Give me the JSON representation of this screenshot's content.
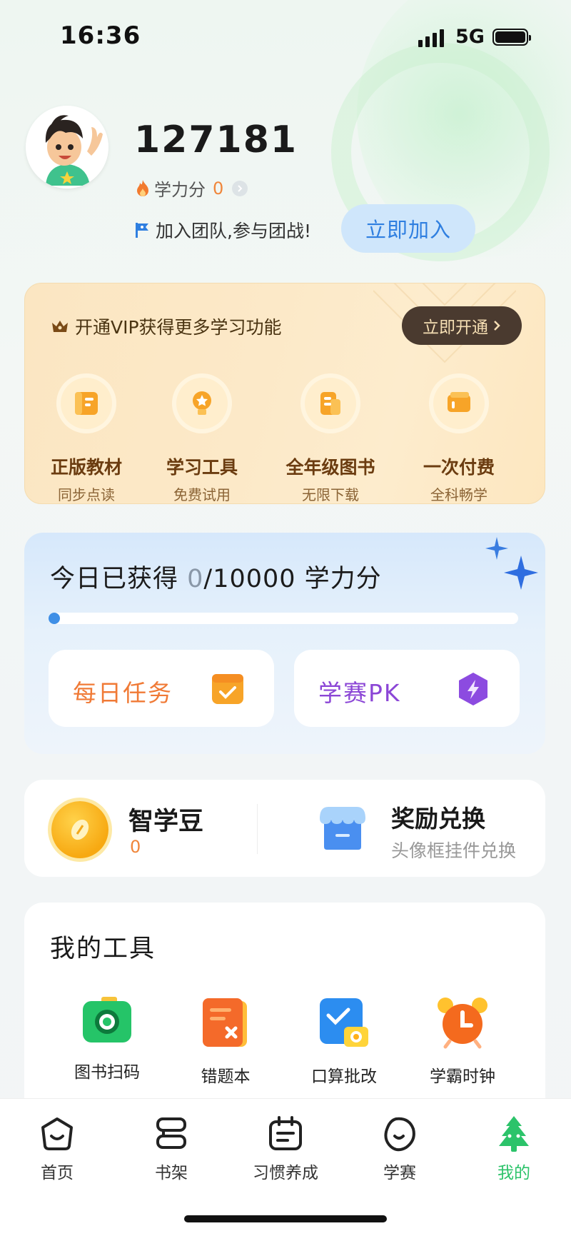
{
  "status_bar": {
    "time": "16:36",
    "network": "5G"
  },
  "profile": {
    "username": "127181",
    "score_label": "学力分",
    "score_value": "0",
    "team_text": "加入团队,参与团战!",
    "join_button": "立即加入"
  },
  "vip": {
    "title": "开通VIP获得更多学习功能",
    "button": "立即开通",
    "items": [
      {
        "name": "正版教材",
        "sub": "同步点读",
        "icon": "textbook-icon"
      },
      {
        "name": "学习工具",
        "sub": "免费试用",
        "icon": "lightbulb-icon"
      },
      {
        "name": "全年级图书",
        "sub": "无限下载",
        "icon": "book-icon"
      },
      {
        "name": "一次付费",
        "sub": "全科畅学",
        "icon": "card-icon"
      }
    ]
  },
  "daily": {
    "title_prefix": "今日已获得 ",
    "earned": "0",
    "title_suffix": "/10000 学力分",
    "progress_fraction": 0,
    "task_button": "每日任务",
    "pk_button": "学赛PK"
  },
  "beans": {
    "title": "智学豆",
    "value": "0",
    "reward_title": "奖励兑换",
    "reward_sub": "头像框挂件兑换"
  },
  "tools": {
    "title": "我的工具",
    "items": [
      {
        "name": "图书扫码",
        "icon": "camera-scan-icon"
      },
      {
        "name": "错题本",
        "icon": "mistake-notebook-icon"
      },
      {
        "name": "口算批改",
        "icon": "photo-check-icon"
      },
      {
        "name": "学霸时钟",
        "icon": "alarm-clock-icon"
      }
    ]
  },
  "tabbar": {
    "items": [
      {
        "label": "首页",
        "icon": "home-icon"
      },
      {
        "label": "书架",
        "icon": "bookshelf-icon"
      },
      {
        "label": "习惯养成",
        "icon": "habit-icon"
      },
      {
        "label": "学赛",
        "icon": "contest-icon"
      },
      {
        "label": "我的",
        "icon": "tree-icon"
      }
    ],
    "active": "我的"
  },
  "colors": {
    "accent_green": "#2cc36a",
    "accent_blue": "#2f7fe0",
    "accent_orange": "#f0863b",
    "vip_dark": "#4a3a2f"
  }
}
